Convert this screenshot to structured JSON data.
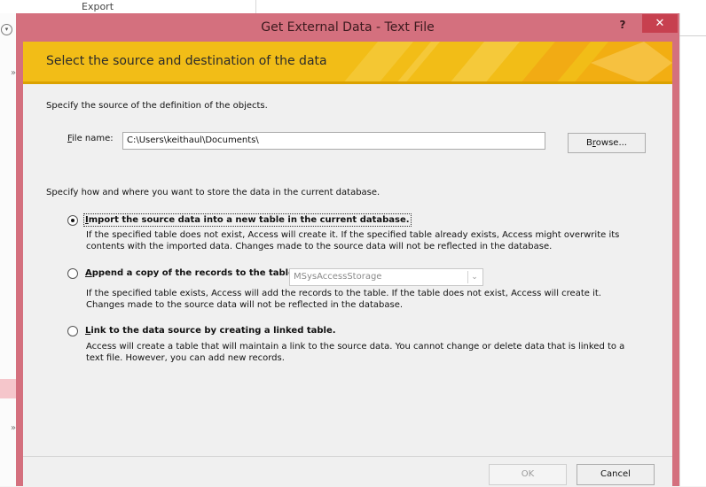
{
  "background": {
    "ribbon_group": "Export"
  },
  "dialog": {
    "title": "Get External Data - Text File",
    "help": "?",
    "close": "✕",
    "banner": "Select the source and destination of the data",
    "source_intro": "Specify the source of the definition of the objects.",
    "file_name_label_u": "F",
    "file_name_label_rest": "ile name:",
    "file_name_value": "C:\\Users\\keithaul\\Documents\\",
    "browse_a": "B",
    "browse_u": "r",
    "browse_b": "owse...",
    "store_intro": "Specify how and where you want to store the data in the current database.",
    "options": [
      {
        "u": "I",
        "label_rest": "mport the source data into a new table in the current database.",
        "selected": true,
        "desc1": "If the specified table does not exist, Access will create it. If the specified table already exists, Access might overwrite its",
        "desc2": "contents with the imported data. Changes made to the source data will not be reflected in the database."
      },
      {
        "u": "A",
        "label_rest": "ppend a copy of the records to the table:",
        "selected": false,
        "dropdown_value": "MSysAccessStorage",
        "desc1": "If the specified table exists, Access will add the records to the table. If the table does not exist, Access will create it.",
        "desc2": "Changes made to the source data will not be reflected in the database."
      },
      {
        "u": "L",
        "label_rest": "ink to the data source by creating a linked table.",
        "selected": false,
        "desc1": "Access will create a table that will maintain a link to the source data. You cannot change or delete data that is linked to a",
        "desc2": "text file. However, you can add new records."
      }
    ],
    "ok": "OK",
    "cancel": "Cancel"
  },
  "colors": {
    "title_bar": "#d4707e",
    "banner": "#f2bd17",
    "close_button": "#c7404f"
  }
}
